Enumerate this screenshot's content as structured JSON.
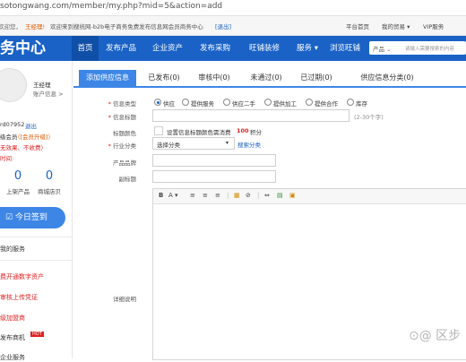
{
  "browser": {
    "url": "sotongwang.com/member/my.php?mid=5&action=add"
  },
  "topstrip": {
    "greeting_prefix": "欢迎您，",
    "user": "王经理!",
    "welcome": "欢迎来到搜统网-b2b电子商务免费发布信息网会员商务中心",
    "logout": "[退出]",
    "links": [
      "平台首页",
      "我的贸易 ▾",
      "VIP服务"
    ]
  },
  "header": {
    "brand": "务中心",
    "nav": [
      "首页",
      "发布产品",
      "企业资产",
      "发布采购",
      "旺铺装修",
      "服务 ▾",
      "浏览旺铺"
    ],
    "search": {
      "select": "产品 ⌄",
      "placeholder": "请输入需要搜索的内容"
    }
  },
  "sidebar": {
    "name": "王经理",
    "account_info": "账户信息 >",
    "member_id": "rd07952",
    "logout": "退出",
    "member_level": "级会员",
    "upgrade": "（[会员升级]）",
    "promo": "无效果、不收费）",
    "time_label": "时间:",
    "stats": [
      {
        "value": "0",
        "label": "上架产品"
      },
      {
        "value": "0",
        "label": "商城店贝"
      }
    ],
    "signin": "☑ 今日签到",
    "my_services": "我的服务",
    "menu": [
      "费开通数字资产",
      "审核上传凭证",
      "级加盟商",
      "发布商机"
    ],
    "hot_badge": "HOT",
    "last_item": "企业服务"
  },
  "tabs": [
    "添加供应信息",
    "已发布(0)",
    "审核中(0)",
    "未通过(0)",
    "已过期(0)",
    "供应信息分类(0)"
  ],
  "form": {
    "type_label": "信息类型",
    "type_options": [
      "供应",
      "提供服务",
      "供应二手",
      "提供加工",
      "提供合作",
      "库存"
    ],
    "title_label": "信息标题",
    "title_hint": "(2-30个字)",
    "color_label": "标题颜色",
    "color_text": "设置信息标题颜色需消费",
    "color_points": "100",
    "color_unit": "积分",
    "category_label": "行业分类",
    "category_value": "选择分类",
    "category_search": "搜索分类",
    "brand_label": "产品品牌",
    "subtitle_label": "副标题",
    "detail_label": "详细说明"
  },
  "editor": {
    "tools": [
      "B",
      "A ▾",
      "≡",
      "≡",
      "≡",
      "|",
      "▦",
      "⊘",
      "|",
      "⇔",
      "▤",
      "▣"
    ]
  },
  "watermark": "⊙@ 区步"
}
